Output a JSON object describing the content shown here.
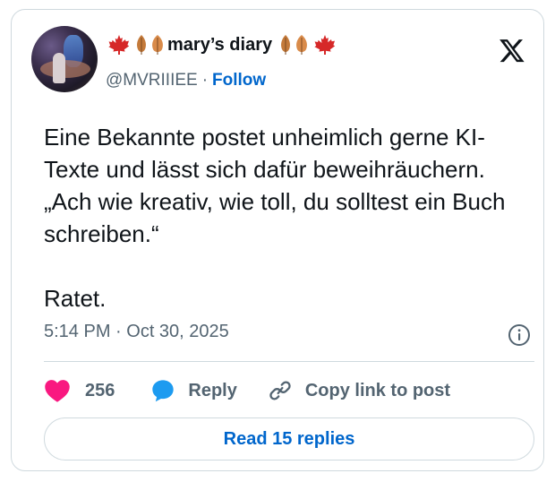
{
  "tweet": {
    "author_name": "mary’s diary",
    "author_handle": "@MVRIIIEE",
    "separator": "·",
    "follow_label": "Follow",
    "body": "Eine Bekannte postet unheimlich gerne KI-Texte und lässt sich dafür beweihräuchern. „Ach wie kreativ, wie toll, du solltest ein Buch schreiben.“\n\nRatet.",
    "timestamp": "5:14 PM · Oct 30, 2025",
    "like_count": "256",
    "reply_label": "Reply",
    "copy_link_label": "Copy link to post",
    "read_replies_label": "Read 15 replies"
  },
  "icons": {
    "brand": "x-logo-icon",
    "info": "info-icon",
    "like": "heart-icon",
    "reply": "speech-bubble-icon",
    "copy": "link-icon",
    "decorations": [
      "maple-leaf-icon",
      "autumn-leaf-icon"
    ]
  },
  "colors": {
    "text": "#0f1419",
    "secondary": "#536471",
    "link": "#0066cc",
    "heart": "#f91880",
    "reply": "#1d9bf0",
    "border": "#cfd9de",
    "maple": "#d62828",
    "leaf": "#c47a3a"
  }
}
